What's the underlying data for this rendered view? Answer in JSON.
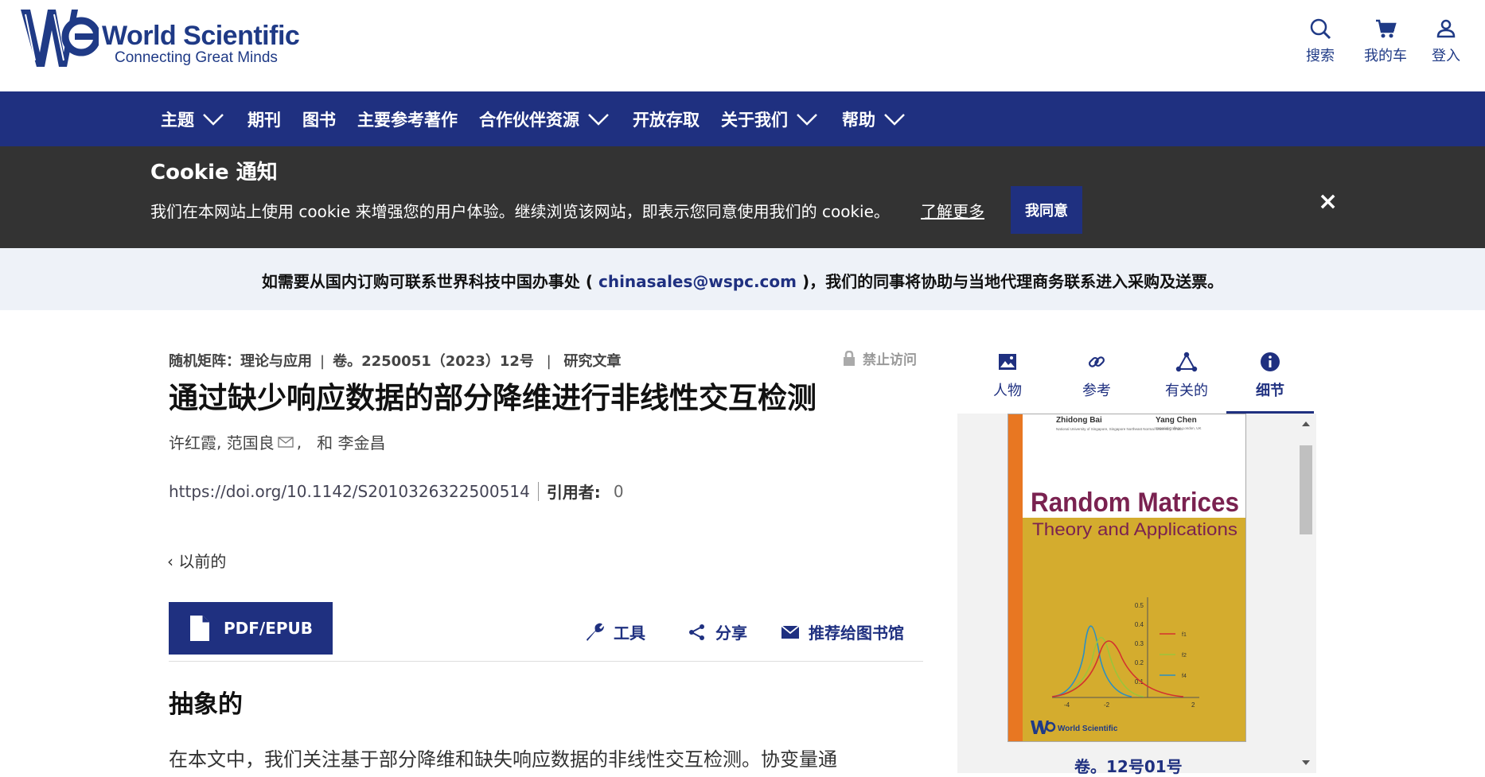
{
  "header": {
    "logo_title": "World Scientific",
    "logo_tagline": "Connecting Great Minds",
    "search_label": "搜索",
    "cart_label": "我的车",
    "login_label": "登入"
  },
  "nav": {
    "items": [
      "主题",
      "期刊",
      "图书",
      "主要参考著作",
      "合作伙伴资源",
      "开放存取",
      "关于我们",
      "帮助"
    ]
  },
  "cookie": {
    "title": "Cookie 通知",
    "text": "我们在本网站上使用 cookie 来增强您的用户体验。继续浏览该网站，即表示您同意使用我们的 cookie。",
    "learn_more": "了解更多",
    "accept": "我同意",
    "close": "×"
  },
  "banner": {
    "prefix": "如需要从国内订购可联系世界科技中国办事处 ( ",
    "email": "chinasales@wspc.com",
    "suffix": " )，我们的同事将协助与当地代理商务联系进入采购及送票。"
  },
  "article": {
    "journal": "随机矩阵：理论与应用",
    "volume": "卷。2250051（2023）12号",
    "type": "研究文章",
    "access": "禁止访问",
    "title": "通过缺少响应数据的部分降维进行非线性交互检测",
    "author_1": "许红霞",
    "author_2": "范国良",
    "author_and": "和",
    "author_3": "李金昌",
    "doi": "https://doi.org/10.1142/S2010326322500514",
    "cited_label": "引用者:",
    "cited_value": "0",
    "prev": "以前的",
    "pdf_label": "PDF/EPUB",
    "tools": "工具",
    "share": "分享",
    "recommend": "推荐给图书馆",
    "abstract_heading": "抽象的",
    "abstract_text": "在本文中，我们关注基于部分降维和缺失响应数据的非线性交互检测。协变量通"
  },
  "side": {
    "tabs": [
      "人物",
      "参考",
      "有关的",
      "细节"
    ],
    "active_tab": "细节",
    "cover": {
      "author_1": "Zhidong Bai",
      "author_2": "Yang Chen",
      "affil_1": "National University of Singapore, Singapore\nNortheast Normal University, China",
      "affil_2": "Imperial College London, UK",
      "title": "Random Matrices",
      "subtitle": "Theory and Applications",
      "publisher": "World Scientific",
      "y_ticks": [
        "0.5",
        "0.4",
        "0.3",
        "0.2",
        "0.1"
      ],
      "x_ticks": [
        "-4",
        "-2",
        "2"
      ],
      "legend": [
        "f1",
        "f2",
        "f4"
      ]
    },
    "volume_caption": "卷。12号01号"
  },
  "colors": {
    "brand_navy": "#1f3080",
    "cookie_bg": "#333333",
    "banner_bg": "#eef2f8",
    "cover_yellow": "#d4ac2e",
    "cover_orange": "#e87722"
  }
}
